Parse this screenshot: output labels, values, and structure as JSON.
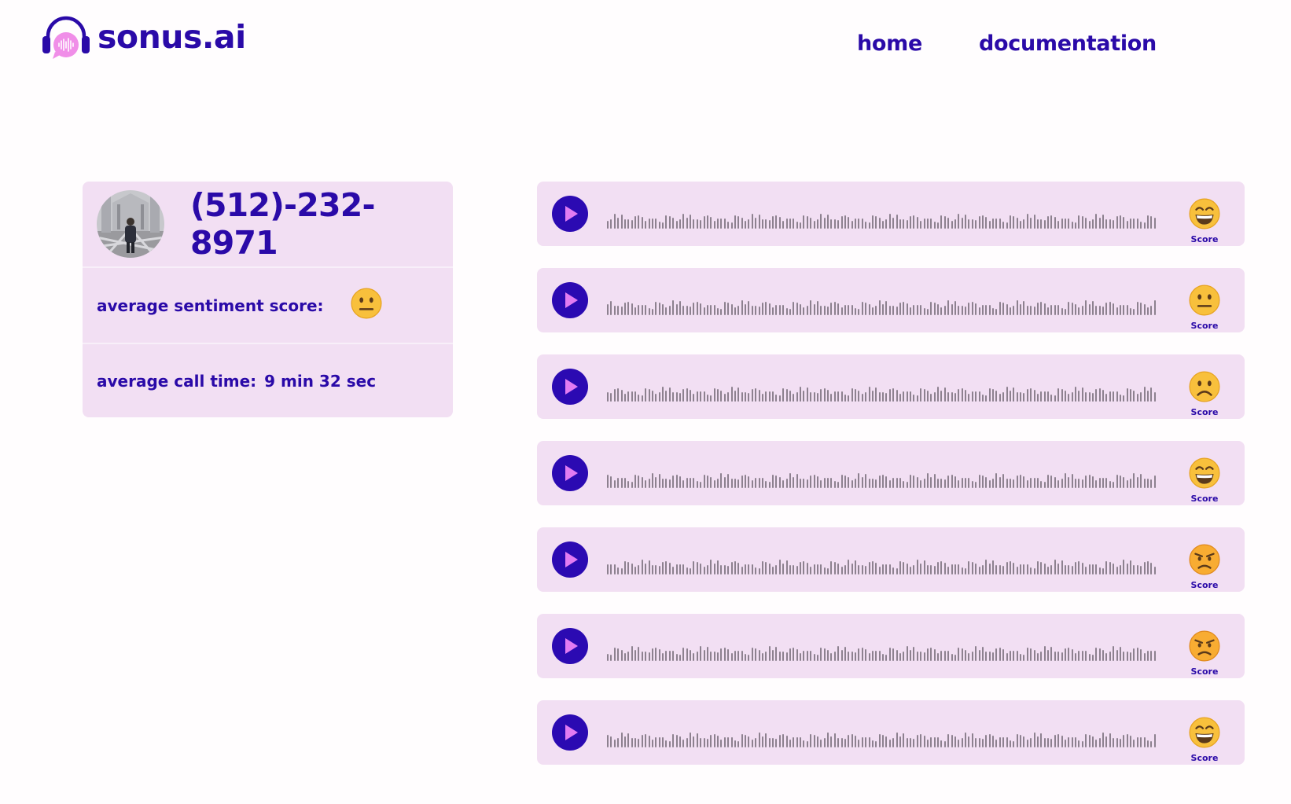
{
  "brand": {
    "name": "sonus.ai",
    "logo_icon": "headphones-chat-waveform-icon"
  },
  "nav": {
    "items": [
      {
        "label": "home"
      },
      {
        "label": "documentation"
      }
    ]
  },
  "profile": {
    "avatar": "person-photo-avatar",
    "phone": "(512)-232-8971",
    "avg_sentiment_label": "average sentiment score:",
    "avg_sentiment": "neutral",
    "avg_call_time_label": "average call time:",
    "avg_call_time": "9 min 32 sec"
  },
  "calls": [
    {
      "sentiment": "grinning",
      "score_label": "Score"
    },
    {
      "sentiment": "neutral",
      "score_label": "Score"
    },
    {
      "sentiment": "frowning",
      "score_label": "Score"
    },
    {
      "sentiment": "grinning",
      "score_label": "Score"
    },
    {
      "sentiment": "angry",
      "score_label": "Score"
    },
    {
      "sentiment": "angry",
      "score_label": "Score"
    },
    {
      "sentiment": "grinning",
      "score_label": "Score"
    }
  ],
  "colors": {
    "primary": "#2a0aa8",
    "card_background": "#f2dff3",
    "play_button": "#2b0ab2",
    "play_triangle": "#e27cf2",
    "waveform": "#8d818f",
    "logo_bubble": "#f08ee8"
  }
}
